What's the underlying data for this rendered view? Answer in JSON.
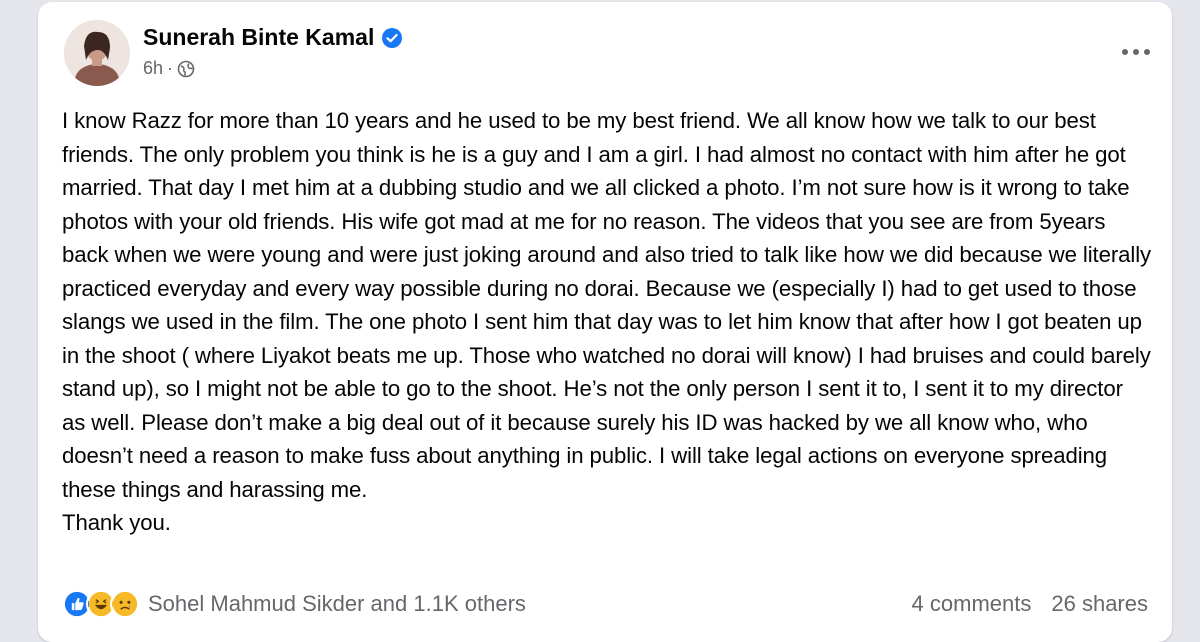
{
  "post": {
    "author": "Sunerah Binte Kamal",
    "time": "6h",
    "separator": "·",
    "text": "I know Razz for more than 10 years and he used to be my best friend. We all know how we talk to our best friends. The only problem you think is he is a guy and I am a girl. I had almost no contact with him after he got married. That day I met him at a dubbing studio and we all clicked a photo. I’m not sure how is it wrong to take photos with your old friends. His wife got mad at me for no reason. The videos that you see are from 5years back when we were young and were just joking around and also tried to talk like how we did because we literally practiced everyday and every way possible during no dorai. Because we (especially I) had to get used to those slangs we used in the film. The one photo I sent him that day was to let him know that after how I got beaten up in the shoot ( where Liyakot beats me up. Those who watched no dorai will know) I had bruises and could barely stand up), so I might not be able to go to the shoot. He’s not the only person I sent it to, I sent it to my director as well. Please don’t make a big deal out of it because surely his ID was hacked by we all know who, who doesn’t need a reason to make fuss about anything in public. I will take legal actions on everyone spreading these things and harassing me.\nThank you.",
    "reaction_names": "Sohel Mahmud Sikder and 1.1K others",
    "comments": "4 comments",
    "shares": "26 shares",
    "reactions": [
      "like-icon",
      "haha-icon",
      "sad-icon"
    ],
    "colors": {
      "verified": "#1877f2",
      "like": "#1877f2",
      "emoji": "#f7b928",
      "secondary_text": "#65676b"
    }
  }
}
